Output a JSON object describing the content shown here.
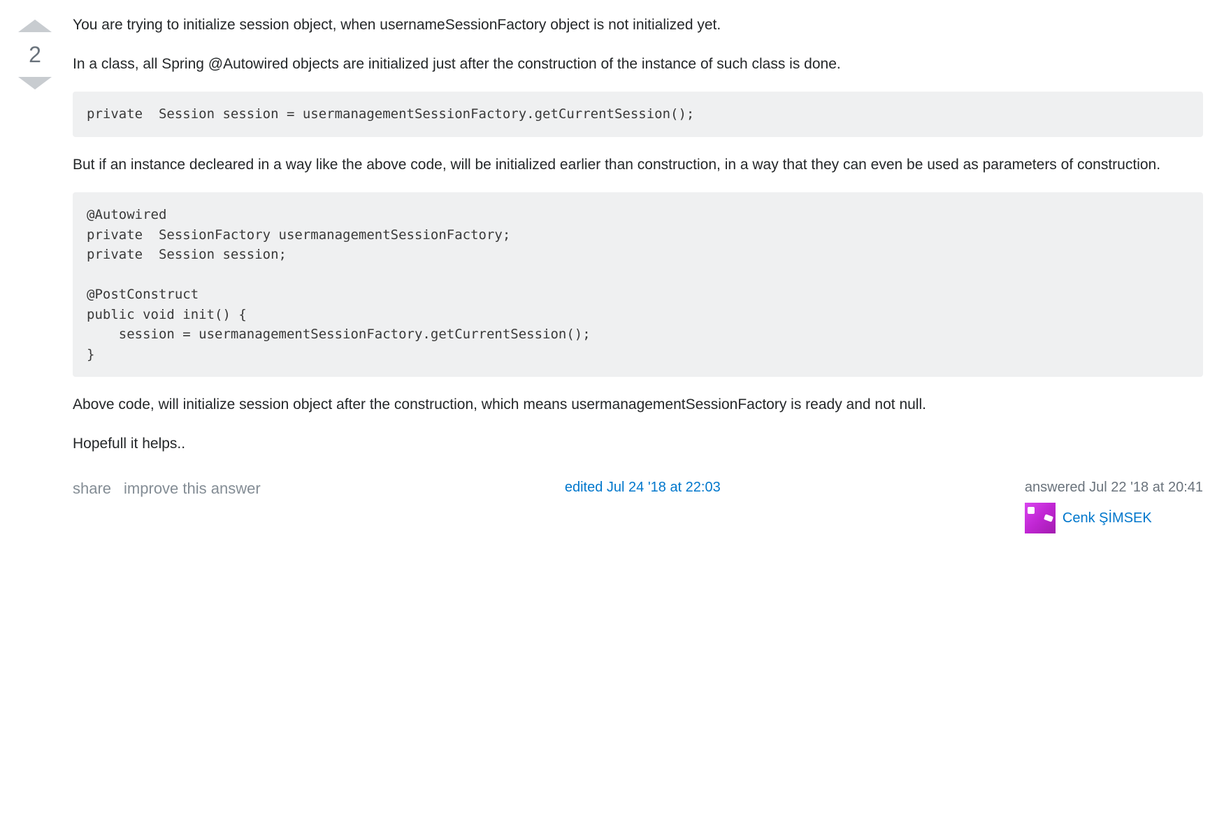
{
  "vote": {
    "count": "2"
  },
  "post": {
    "para1": "You are trying to initialize session object, when usernameSessionFactory object is not initialized yet.",
    "para2": "In a class, all Spring @Autowired objects are initialized just after the construction of the instance of such class is done.",
    "code1": "private  Session session = usermanagementSessionFactory.getCurrentSession();",
    "para3": "But if an instance decleared in a way like the above code, will be initialized earlier than construction, in a way that they can even be used as parameters of construction.",
    "code2": "@Autowired\nprivate  SessionFactory usermanagementSessionFactory;\nprivate  Session session;\n\n@PostConstruct\npublic void init() {\n    session = usermanagementSessionFactory.getCurrentSession();\n}",
    "para4": "Above code, will initialize session object after the construction, which means usermanagementSessionFactory is ready and not null.",
    "para5": "Hopefull it helps.."
  },
  "actions": {
    "share": "share",
    "improve": "improve this answer"
  },
  "edit": {
    "label": "edited Jul 24 '18 at 22:03"
  },
  "answer": {
    "time_label": "answered Jul 22 '18 at 20:41",
    "author_name": "Cenk ŞİMSEK"
  }
}
